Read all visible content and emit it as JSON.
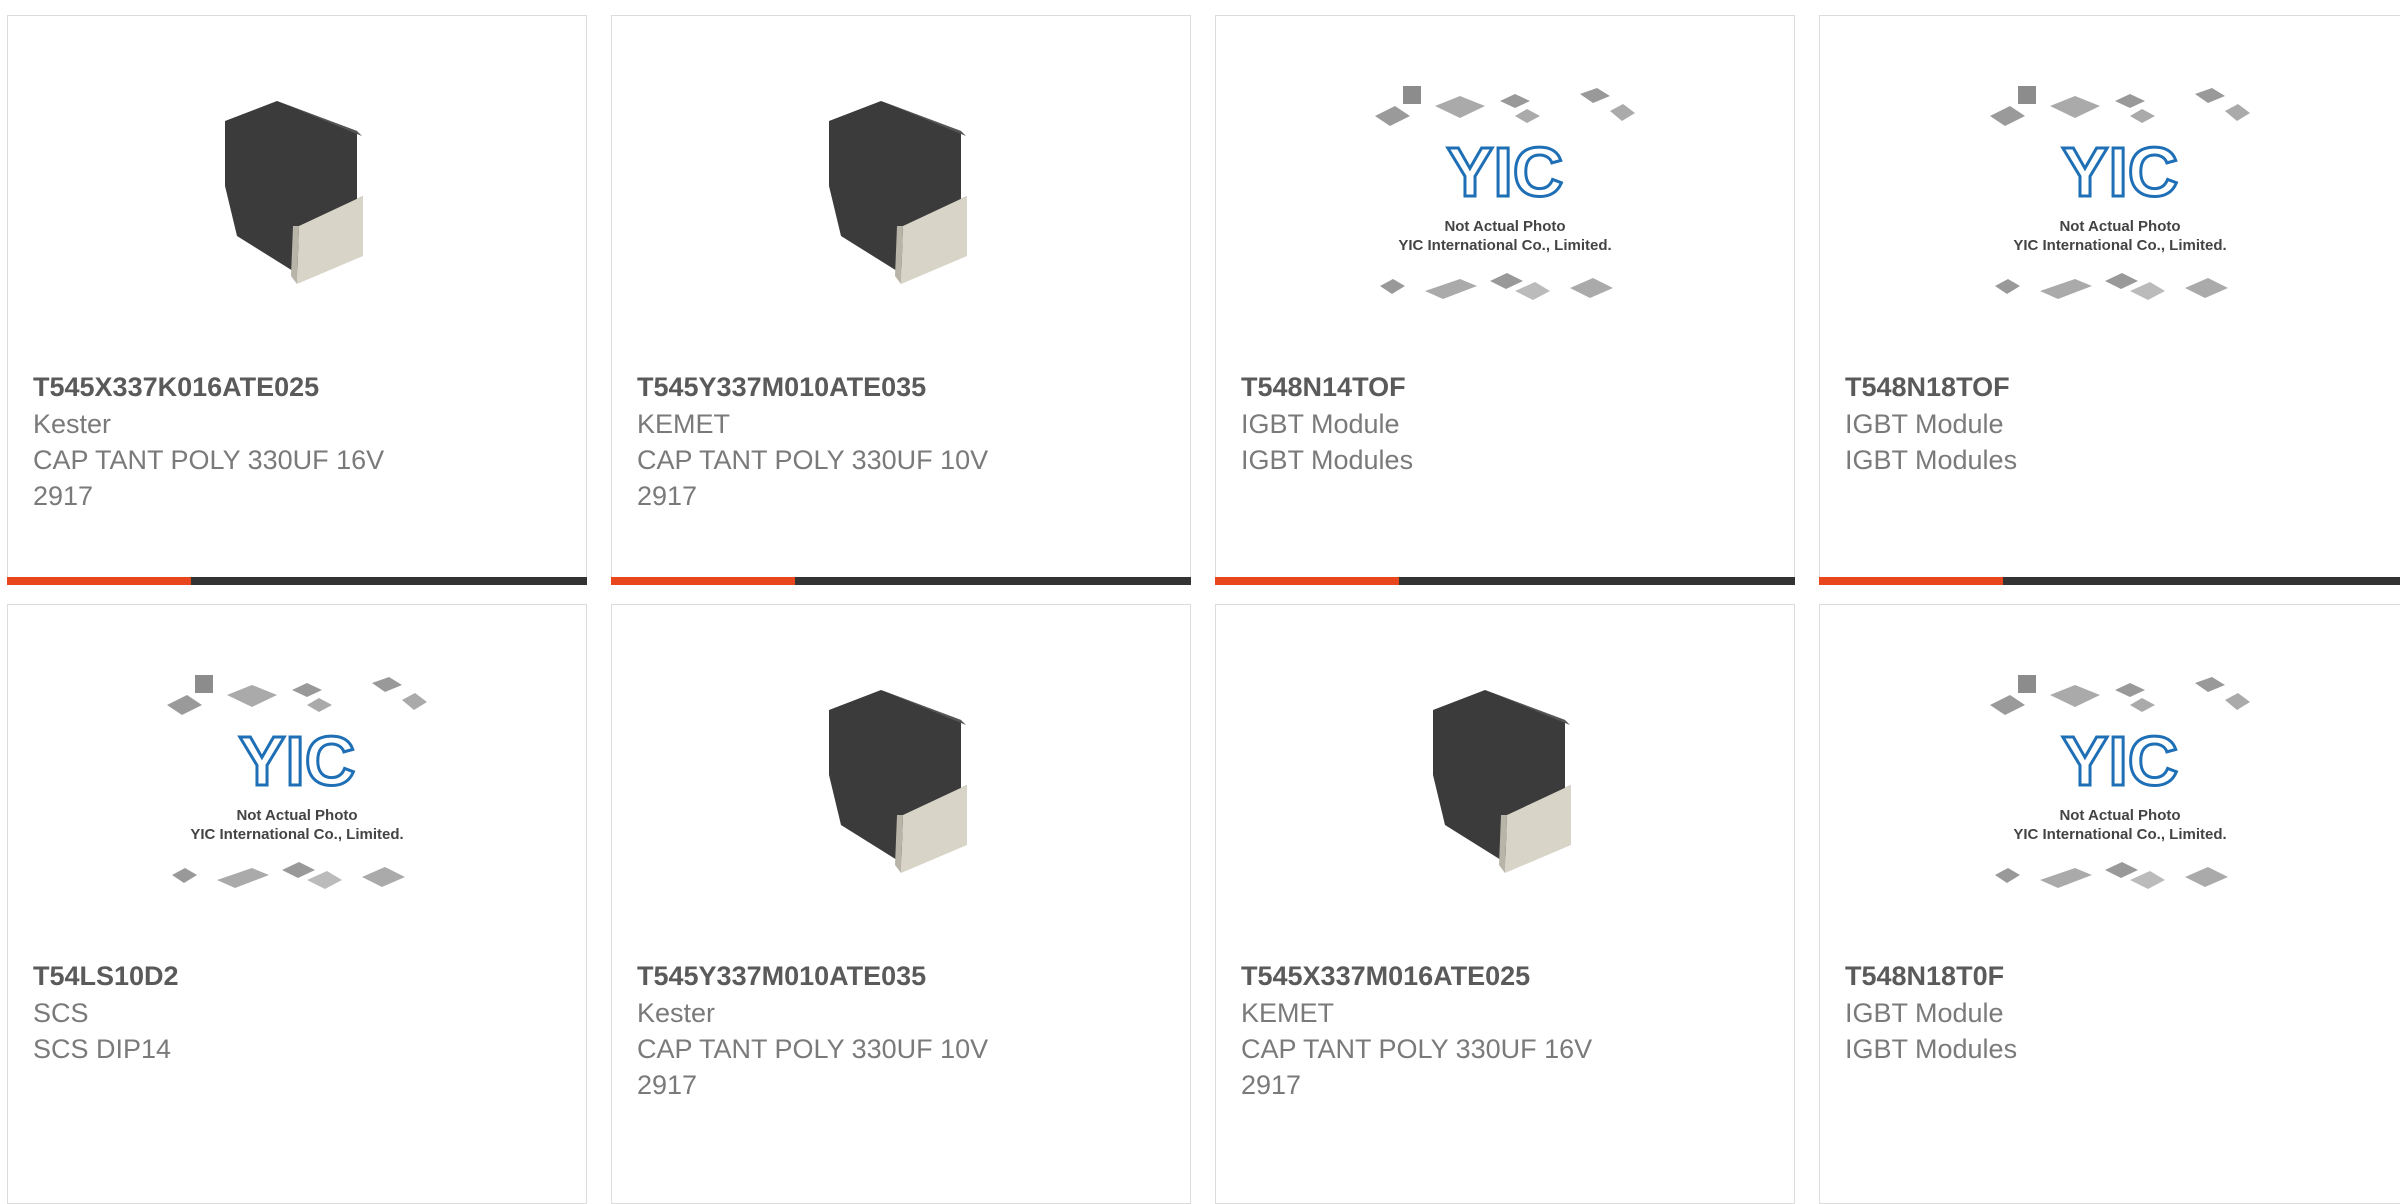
{
  "accent_color": "#e8461d",
  "bar_color": "#333333",
  "cards": [
    {
      "part": "T545X337K016ATE025",
      "manufacturer": "Kester",
      "desc": "CAP TANT POLY 330UF 16V",
      "package": "2917",
      "image": "tantalum-capacitor-image"
    },
    {
      "part": "T545Y337M010ATE035",
      "manufacturer": "KEMET",
      "desc": "CAP TANT POLY 330UF 10V",
      "package": "2917",
      "image": "tantalum-capacitor-image"
    },
    {
      "part": "T548N14TOF",
      "manufacturer": "IGBT Module",
      "desc": "IGBT Modules",
      "package": "",
      "image": "placeholder-image"
    },
    {
      "part": "T548N18TOF",
      "manufacturer": "IGBT Module",
      "desc": "IGBT Modules",
      "package": "",
      "image": "placeholder-image"
    },
    {
      "part": "T54LS10D2",
      "manufacturer": "SCS",
      "desc": "SCS DIP14",
      "package": "",
      "image": "placeholder-image"
    },
    {
      "part": "T545Y337M010ATE035",
      "manufacturer": "Kester",
      "desc": "CAP TANT POLY 330UF 10V",
      "package": "2917",
      "image": "tantalum-capacitor-image"
    },
    {
      "part": "T545X337M016ATE025",
      "manufacturer": "KEMET",
      "desc": "CAP TANT POLY 330UF 16V",
      "package": "2917",
      "image": "tantalum-capacitor-image"
    },
    {
      "part": "T548N18T0F",
      "manufacturer": "IGBT Module",
      "desc": "IGBT Modules",
      "package": "",
      "image": "placeholder-image"
    }
  ],
  "placeholder": {
    "logo": "YIC",
    "line1": "Not Actual Photo",
    "line2": "YIC International Co., Limited."
  }
}
